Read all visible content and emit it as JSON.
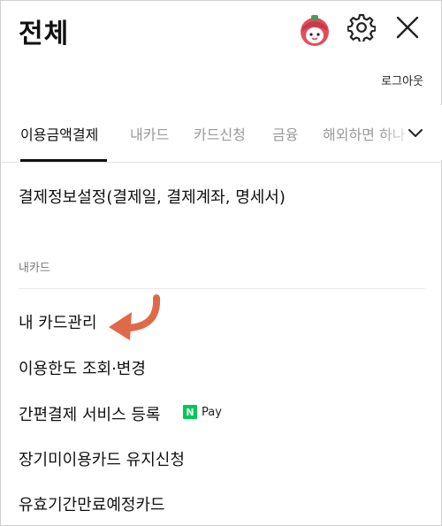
{
  "header": {
    "title": "전체",
    "logout_label": "로그아웃"
  },
  "tabs": [
    {
      "label": "이용금액결제",
      "active": true
    },
    {
      "label": "내카드",
      "active": false
    },
    {
      "label": "카드신청",
      "active": false
    },
    {
      "label": "금융",
      "active": false
    },
    {
      "label": "해외하면 하나",
      "active": false
    }
  ],
  "menu": {
    "payment_settings": "결제정보설정(결제일, 결제계좌, 명세서)",
    "section_label": "내카드",
    "items": [
      "내 카드관리",
      "이용한도 조회·변경",
      "간편결제 서비스 등록",
      "장기미이용카드 유지신청",
      "유효기간만료예정카드"
    ],
    "npay_label": "Pay",
    "npay_mark": "N"
  },
  "colors": {
    "accent_arrow": "#e0694a",
    "npay_green": "#03c75a",
    "avatar_red": "#e44d5b"
  },
  "icons": {
    "avatar": "mascot-avatar-icon",
    "settings": "gear-icon",
    "close": "close-icon",
    "tabs_more": "chevron-down-icon",
    "pointer": "curved-arrow-icon"
  }
}
